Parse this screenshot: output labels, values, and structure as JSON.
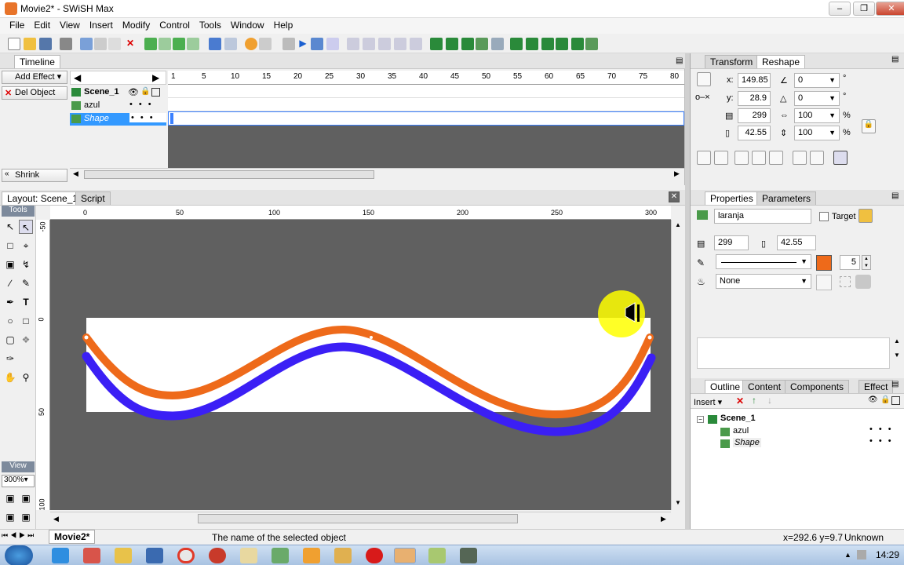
{
  "window": {
    "title": "Movie2* - SWiSH Max"
  },
  "menu": [
    "File",
    "Edit",
    "View",
    "Insert",
    "Modify",
    "Control",
    "Tools",
    "Window",
    "Help"
  ],
  "timeline": {
    "tab": "Timeline",
    "add_effect": "Add Effect",
    "del_object": "Del Object",
    "shrink": "Shrink",
    "scene": "Scene_1",
    "layers": [
      "azul",
      "Shape"
    ],
    "frame_ticks": [
      "1",
      "5",
      "10",
      "15",
      "20",
      "25",
      "30",
      "35",
      "40",
      "45",
      "50",
      "55",
      "60",
      "65",
      "70",
      "75",
      "80"
    ]
  },
  "layout": {
    "tab": "Layout: Scene_1",
    "script_tab": "Script",
    "tools_label": "Tools",
    "view_label": "View",
    "zoom": "300%",
    "hruler": [
      "0",
      "50",
      "100",
      "150",
      "200",
      "250",
      "300"
    ],
    "vruler": [
      "-50",
      "0",
      "50",
      "100"
    ]
  },
  "transform": {
    "tabs": [
      "Transform",
      "Reshape"
    ],
    "x_label": "x:",
    "x": "149.85",
    "y_label": "y:",
    "y": "28.9",
    "w": "299",
    "h": "42.55",
    "rot": "0",
    "skew": "0",
    "scale_w": "100",
    "scale_h": "100",
    "pct": "%",
    "deg": "°"
  },
  "properties": {
    "tabs": [
      "Properties",
      "Parameters"
    ],
    "name": "laranja",
    "target": "Target",
    "w": "299",
    "h": "42.55",
    "line_width": "5",
    "fill": "None",
    "line_color": "#ee6a1a"
  },
  "outline": {
    "tabs": [
      "Outline",
      "Content",
      "Components",
      "Effect"
    ],
    "insert": "Insert",
    "scene": "Scene_1",
    "items": [
      "azul",
      "Shape"
    ]
  },
  "status": {
    "hint": "The name of the selected object",
    "coords": "x=292.6 y=9.7",
    "size": "Unknown Size",
    "doc_tab": "Movie2*"
  },
  "taskbar": {
    "clock": "14:29"
  },
  "colors": {
    "orange": "#ee6a1a",
    "blue": "#3b1ff5",
    "stage": "#606060",
    "cursor": "#ffff00"
  }
}
